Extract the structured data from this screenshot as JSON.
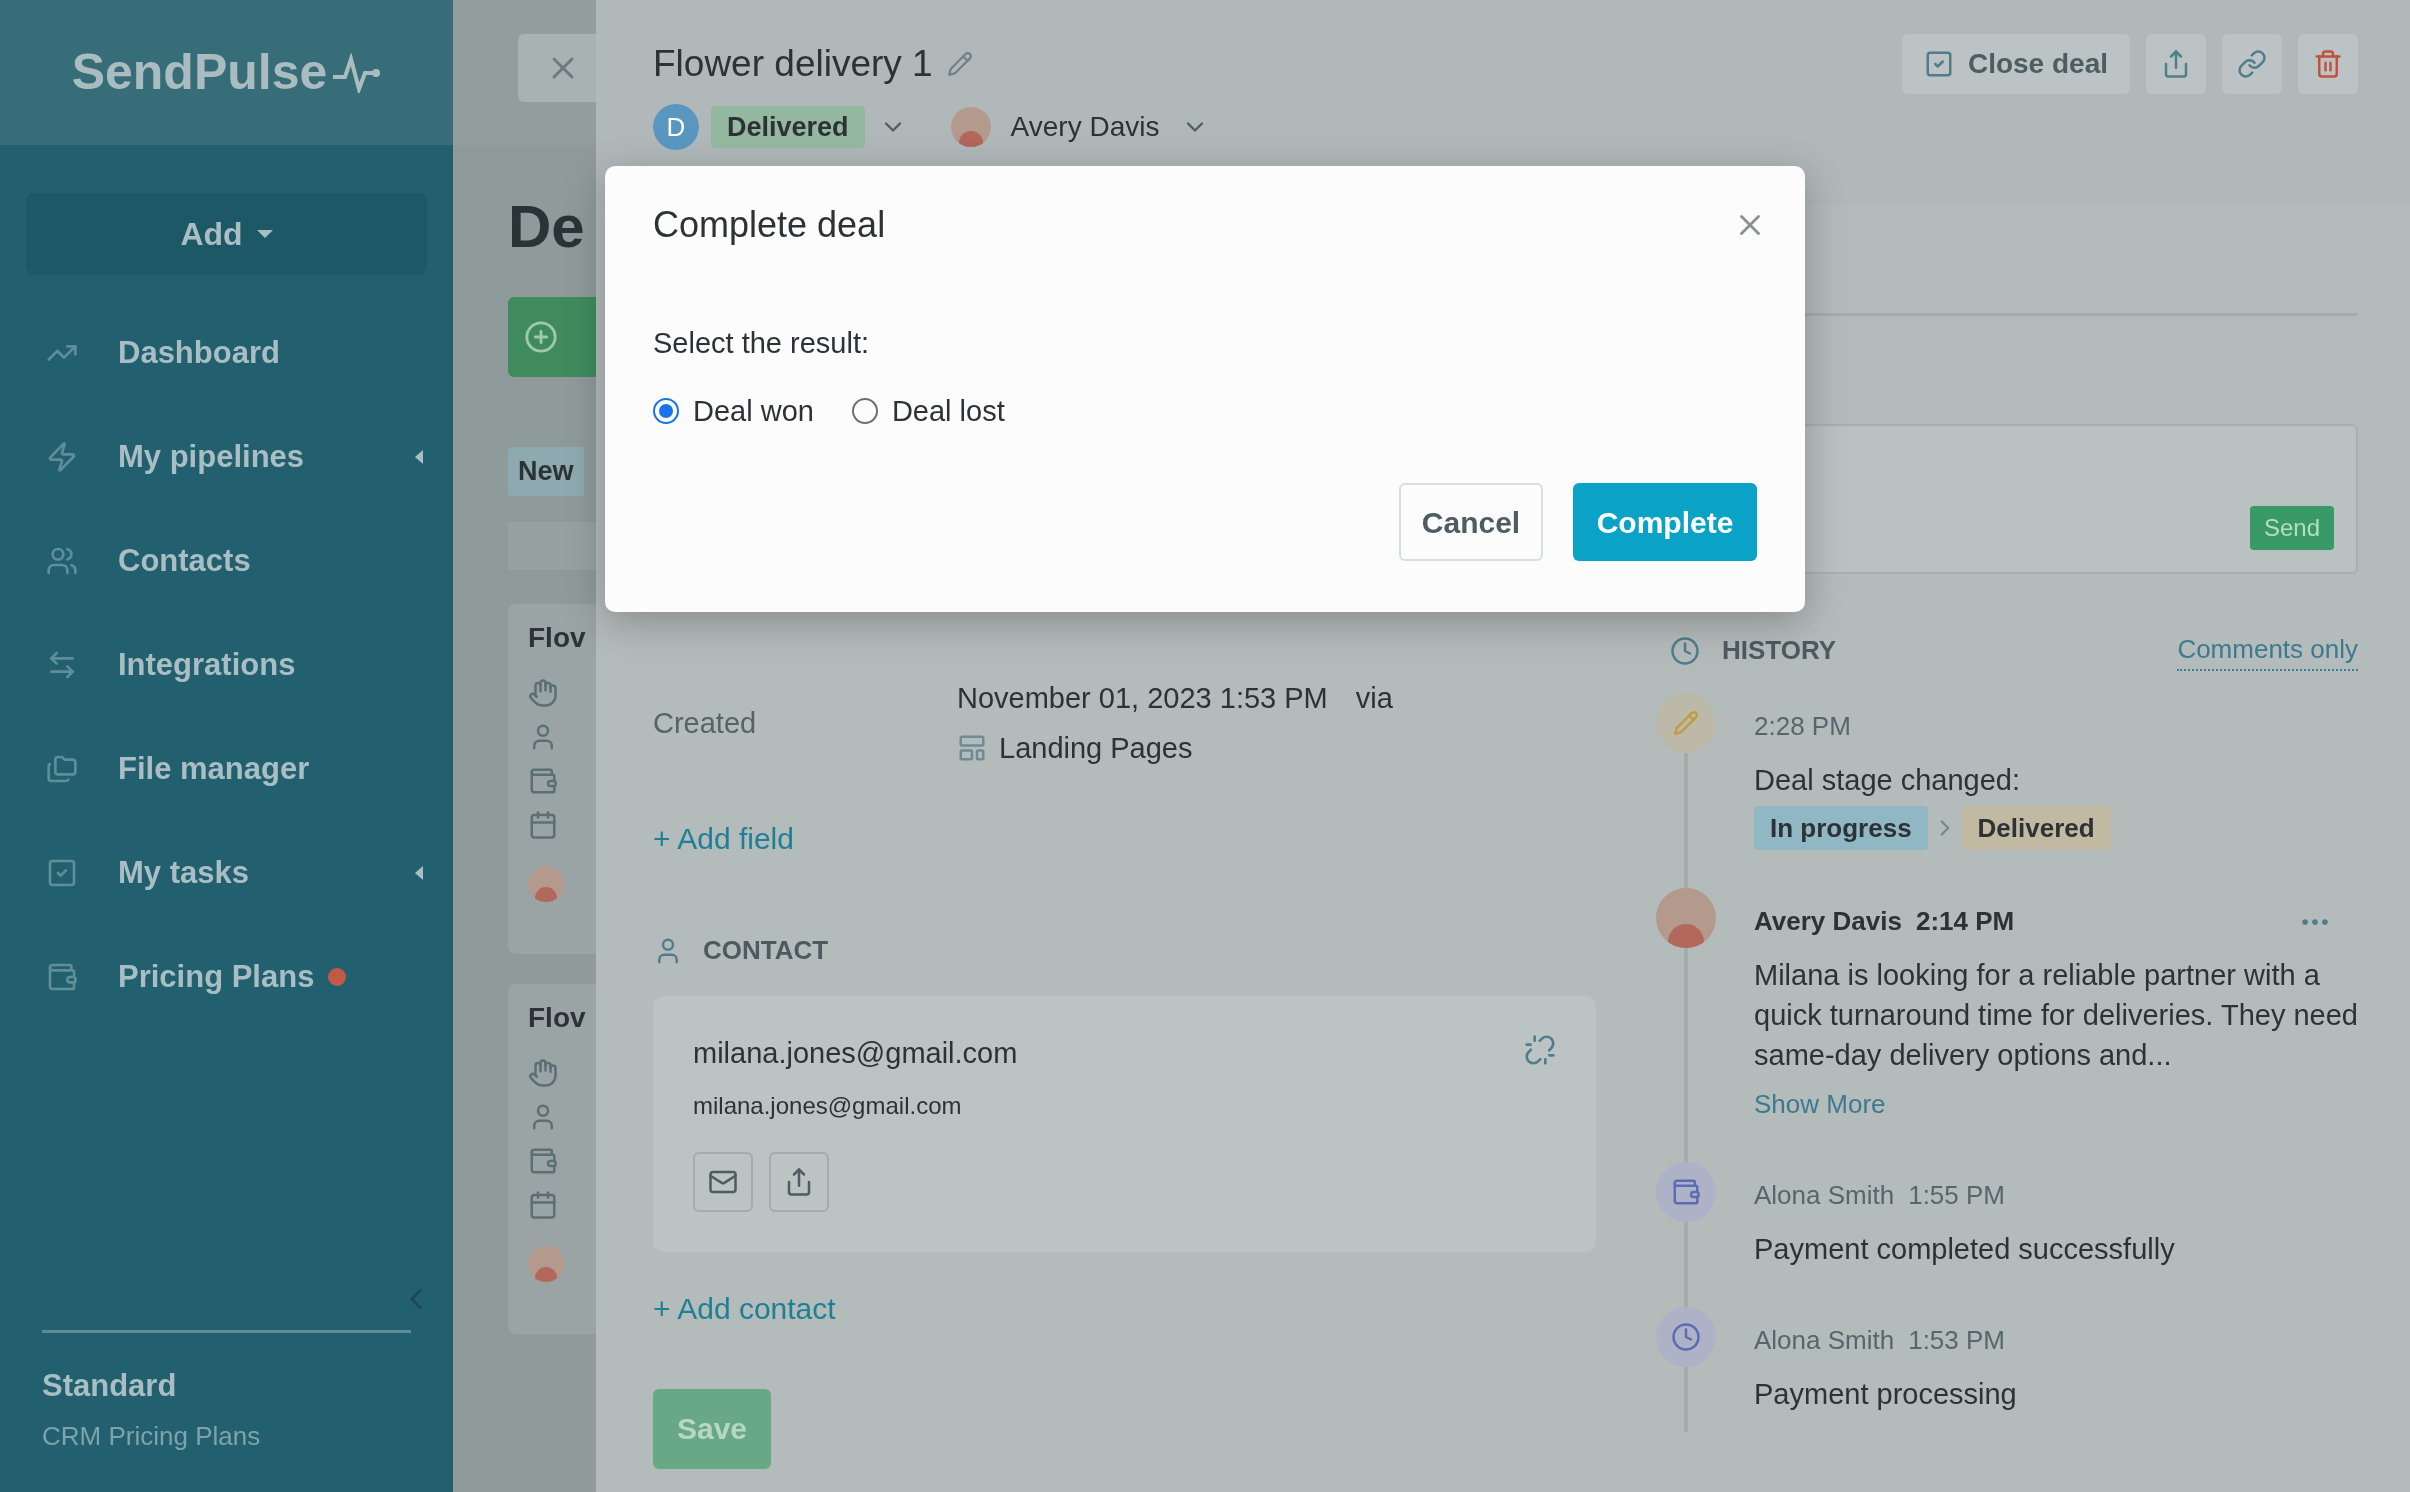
{
  "sidebar": {
    "logo": "SendPulse",
    "add_button": "Add",
    "items": [
      {
        "label": "Dashboard",
        "expandable": false,
        "badge": false
      },
      {
        "label": "My pipelines",
        "expandable": true,
        "badge": false
      },
      {
        "label": "Contacts",
        "expandable": false,
        "badge": false
      },
      {
        "label": "Integrations",
        "expandable": false,
        "badge": false
      },
      {
        "label": "File manager",
        "expandable": false,
        "badge": false
      },
      {
        "label": "My tasks",
        "expandable": true,
        "badge": false
      },
      {
        "label": "Pricing Plans",
        "expandable": false,
        "badge": true
      }
    ],
    "plan": {
      "name": "Standard",
      "subtitle": "CRM Pricing Plans"
    }
  },
  "background_page": {
    "title": "De",
    "tab": "New",
    "cards": [
      {
        "title": "Flov"
      },
      {
        "title": "Flov"
      }
    ]
  },
  "deal": {
    "title": "Flower delivery 1",
    "stage": {
      "initial": "D",
      "label": "Delivered"
    },
    "owner": "Avery Davis",
    "close_button": "Close deal",
    "fields": [
      {
        "label": "Created",
        "value": "November 01, 2023 1:53 PM",
        "via": "via",
        "source": "Landing Pages"
      }
    ],
    "add_field": "+ Add field",
    "contact_heading": "CONTACT",
    "contact": {
      "name": "milana.jones@gmail.com",
      "email": "milana.jones@gmail.com"
    },
    "add_contact": "+ Add contact",
    "save": "Save"
  },
  "comment": {
    "send": "Send"
  },
  "history": {
    "title": "HISTORY",
    "filter": "Comments only",
    "entries": [
      {
        "kind": "stage",
        "time": "2:28 PM",
        "text": "Deal stage changed:",
        "from": "In progress",
        "to": "Delivered"
      },
      {
        "kind": "comment",
        "author": "Avery Davis",
        "time": "2:14 PM",
        "text": "Milana is looking for a reliable partner with a quick turnaround time for deliveries. They need same-day delivery options and...",
        "more": "Show More"
      },
      {
        "kind": "payment",
        "author": "Alona Smith",
        "time": "1:55 PM",
        "text": "Payment completed successfully"
      },
      {
        "kind": "pending",
        "author": "Alona Smith",
        "time": "1:53 PM",
        "text": "Payment processing"
      }
    ]
  },
  "modal": {
    "title": "Complete deal",
    "prompt": "Select the result:",
    "options": [
      {
        "label": "Deal won",
        "selected": true
      },
      {
        "label": "Deal lost",
        "selected": false
      }
    ],
    "cancel": "Cancel",
    "confirm": "Complete"
  }
}
